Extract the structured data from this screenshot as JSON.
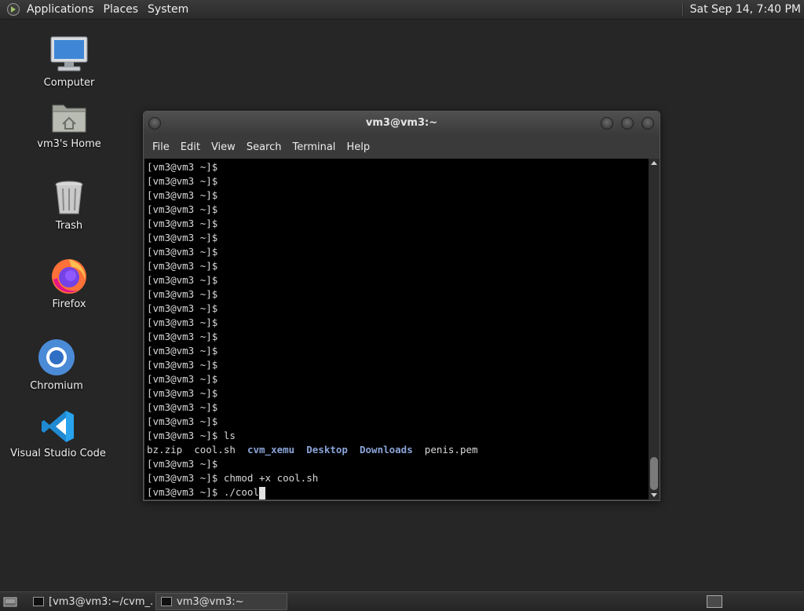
{
  "top_panel": {
    "menus": [
      "Applications",
      "Places",
      "System"
    ],
    "clock": "Sat Sep 14,  7:40 PM"
  },
  "desktop_icons": [
    {
      "label": "Computer",
      "icon": "computer-icon"
    },
    {
      "label": "vm3's Home",
      "icon": "home-folder-icon"
    },
    {
      "label": "Trash",
      "icon": "trash-icon"
    },
    {
      "label": "Firefox",
      "icon": "firefox-icon"
    },
    {
      "label": "Chromium",
      "icon": "chromium-icon"
    },
    {
      "label": "Visual Studio Code",
      "icon": "vscode-icon"
    }
  ],
  "terminal": {
    "title": "vm3@vm3:~",
    "menu": [
      "File",
      "Edit",
      "View",
      "Search",
      "Terminal",
      "Help"
    ],
    "prompt": "[vm3@vm3 ~]$",
    "ls_command": "[vm3@vm3 ~]$ ls",
    "ls_output": [
      {
        "name": "bz.zip",
        "type": "file"
      },
      {
        "name": "cool.sh",
        "type": "file"
      },
      {
        "name": "cvm_xemu",
        "type": "dir"
      },
      {
        "name": "Desktop",
        "type": "dir"
      },
      {
        "name": "Downloads",
        "type": "dir"
      },
      {
        "name": "penis.pem",
        "type": "file"
      }
    ],
    "after_ls_prompt": "[vm3@vm3 ~]$",
    "chmod_command": "[vm3@vm3 ~]$ chmod +x cool.sh",
    "current_input": "[vm3@vm3 ~]$ ./cool"
  },
  "taskbar": {
    "tasks": [
      {
        "label": "[vm3@vm3:~/cvm_...",
        "active": false
      },
      {
        "label": "vm3@vm3:~",
        "active": true
      }
    ]
  },
  "colors": {
    "desktop_bg": "#262626",
    "terminal_bg": "#000000",
    "terminal_fg": "#d8d8d8",
    "directory_fg": "#8aa4d8"
  }
}
